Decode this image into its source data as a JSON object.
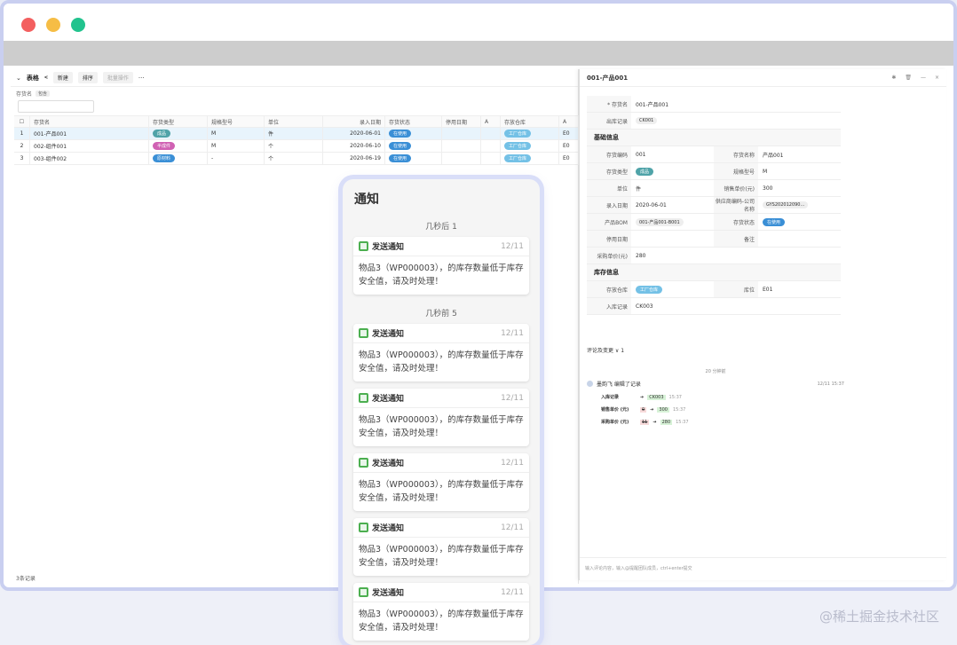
{
  "toolbar": {
    "title": "表格",
    "btn_add": "新建",
    "btn_sort": "排序",
    "btn_batch": "批量操作",
    "btn_more": "···"
  },
  "filter": {
    "label": "存货名",
    "tag": "包含"
  },
  "table": {
    "columns": [
      "存货名",
      "存货类型",
      "规格型号",
      "单位",
      "录入日期",
      "存货状态",
      "停用日期",
      "A",
      "存放仓库",
      "A"
    ],
    "rows": [
      {
        "idx": "1",
        "name": "001-产品001",
        "type": "成品",
        "spec": "M",
        "unit": "件",
        "date": "2020-06-01",
        "status": "在使用",
        "warehouse": "工厂仓库",
        "loc": "E0"
      },
      {
        "idx": "2",
        "name": "002-组件001",
        "type": "半成件",
        "spec": "M",
        "unit": "个",
        "date": "2020-06-10",
        "status": "在使用",
        "warehouse": "工厂仓库",
        "loc": "E0"
      },
      {
        "idx": "3",
        "name": "003-组件002",
        "type": "原材料",
        "spec": "-",
        "unit": "个",
        "date": "2020-06-19",
        "status": "在使用",
        "warehouse": "工厂仓库",
        "loc": "E0"
      }
    ],
    "footer": "3条记录"
  },
  "detail": {
    "title": "001-产品001",
    "icons": [
      "✱",
      "🗑",
      "—",
      "×"
    ],
    "fields": {
      "name_label": "* 存货名",
      "name_value": "001-产品001",
      "out_label": "出库记录",
      "out_value": "CK001",
      "section_basic": "基础信息",
      "code_label": "存货编码",
      "code_value": "001",
      "fullname_label": "存货名称",
      "fullname_value": "产品001",
      "type_label": "存货类型",
      "type_value": "成品",
      "spec_label": "规格型号",
      "spec_value": "M",
      "unit_label": "单位",
      "unit_value": "件",
      "price_label": "销售单价(元)",
      "price_value": "300",
      "date_label": "录入日期",
      "date_value": "2020-06-01",
      "supplier_label": "供应商编码-公司名称",
      "supplier_value": "GYS202012090…",
      "bom_label": "产品BOM",
      "bom_value": "001-产品001-B001",
      "status_label": "存货状态",
      "status_value": "在使用",
      "stop_label": "停用日期",
      "stop_value": "",
      "remark_label": "备注",
      "remark_value": "",
      "cost_label": "采购单价(元)",
      "cost_value": "280",
      "section_stock": "库存信息",
      "warehouse_label": "存放仓库",
      "warehouse_value": "工厂仓库",
      "loc_label": "库位",
      "loc_value": "E01",
      "in_label": "入库记录",
      "in_value": "CK003"
    },
    "comments": {
      "header": "评论及变更 ∨ 1",
      "time_center": "20 分钟前",
      "user_line": "墨韵飞 编辑了记录",
      "user_ts": "12/11 15:37",
      "changes": [
        {
          "label": "入库记录",
          "old": "",
          "new": "CK003",
          "ts": "15:37"
        },
        {
          "label": "销售单价 (元)",
          "old": "0",
          "new": "300",
          "ts": "15:37"
        },
        {
          "label": "采购单价 (元)",
          "old": "11",
          "new": "280",
          "ts": "15:37"
        }
      ],
      "input_placeholder": "输入评论内容，输入@提醒团队成员，ctrl+enter提交"
    }
  },
  "notify": {
    "title": "通知",
    "groups": [
      {
        "label": "几秒后 1",
        "cards": [
          {
            "title": "发送通知",
            "date": "12/11",
            "body": "物品3（WP000003），的库存数量低于库存安全值，请及时处理！"
          }
        ]
      },
      {
        "label": "几秒前 5",
        "cards": [
          {
            "title": "发送通知",
            "date": "12/11",
            "body": "物品3（WP000003），的库存数量低于库存安全值，请及时处理！"
          },
          {
            "title": "发送通知",
            "date": "12/11",
            "body": "物品3（WP000003），的库存数量低于库存安全值，请及时处理！"
          },
          {
            "title": "发送通知",
            "date": "12/11",
            "body": "物品3（WP000003），的库存数量低于库存安全值，请及时处理！"
          },
          {
            "title": "发送通知",
            "date": "12/11",
            "body": "物品3（WP000003），的库存数量低于库存安全值，请及时处理！"
          },
          {
            "title": "发送通知",
            "date": "12/11",
            "body": "物品3（WP000003），的库存数量低于库存安全值，请及时处理！"
          }
        ]
      }
    ]
  },
  "watermark": "@稀土掘金技术社区",
  "colors": {
    "frame_border": "#c9cff0",
    "accent_green": "#4caf50",
    "select_blue": "#e8f4fc"
  }
}
